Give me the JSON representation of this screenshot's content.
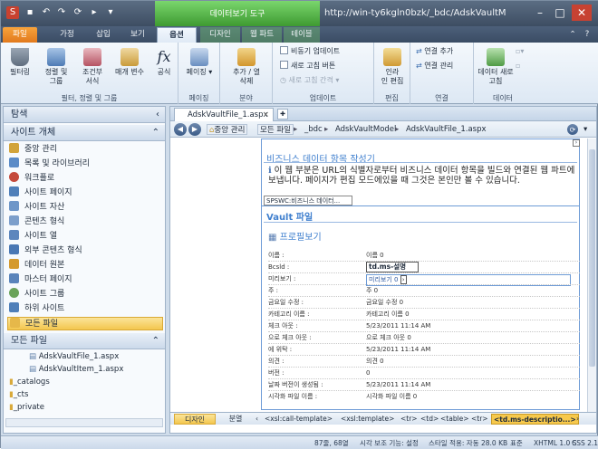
{
  "window": {
    "context_tool": "데이터보기 도구",
    "title": "http://win-ty6kgln0bzk/_bdc/AdskVaultModel..."
  },
  "tabs": [
    {
      "label": "파일"
    },
    {
      "label": "가정"
    },
    {
      "label": "삽입"
    },
    {
      "label": "보기"
    },
    {
      "label": "옵션"
    },
    {
      "label": "디자인"
    },
    {
      "label": "웹 파트"
    },
    {
      "label": "테이블"
    }
  ],
  "ribbon": {
    "g1": {
      "label": "필터, 정렬 및 그룹",
      "b1": "필터링",
      "b2a": "정렬 및",
      "b2b": "그룹",
      "b3a": "조건부",
      "b3b": "서식",
      "b4": "매개 변수",
      "b5": "공식"
    },
    "g2": {
      "label": "페이징",
      "b1": "페이징"
    },
    "g3": {
      "label": "분야",
      "b1a": "추가 / 열",
      "b1b": "삭제"
    },
    "g4": {
      "label": "업데이트",
      "s1": "비동기 업데이트",
      "s2": "새로 고침 버튼",
      "s3": "새로 고침 간격"
    },
    "g5": {
      "label": "편집",
      "b1a": "인라",
      "b1b": "인 편집"
    },
    "g6": {
      "label": "연결",
      "s1": "연결 추가",
      "s2": "연결 관리"
    },
    "g7": {
      "label": "데이터",
      "b1a": "데이터 새로",
      "b1b": "고침"
    }
  },
  "nav": {
    "header": "탐색",
    "section": "사이트 개체",
    "items": [
      {
        "label": "중앙 관리"
      },
      {
        "label": "목록 및 라이브러리"
      },
      {
        "label": "워크플로"
      },
      {
        "label": "사이트 페이지"
      },
      {
        "label": "사이트 자산"
      },
      {
        "label": "콘텐츠 형식"
      },
      {
        "label": "사이트 열"
      },
      {
        "label": "외부 콘텐츠 형식"
      },
      {
        "label": "데이터 원본"
      },
      {
        "label": "마스터 페이지"
      },
      {
        "label": "사이트 그룹"
      },
      {
        "label": "하위 사이트"
      },
      {
        "label": "모든 파일"
      }
    ],
    "section2": "모든 파일",
    "tree": [
      {
        "label": "AdskVaultFile_1.aspx"
      },
      {
        "label": "AdskVaultItem_1.aspx"
      },
      {
        "label": "_catalogs"
      },
      {
        "label": "_cts"
      },
      {
        "label": "_private"
      }
    ]
  },
  "doc": {
    "tab": "AdskVaultFile_1.aspx",
    "crumbs": [
      "중앙 관리",
      "모든 파일",
      "_bdc",
      "AdskVaultModel",
      "AdskVaultFile_1.aspx"
    ],
    "section1_title": "비즈니스 데이터 항목 작성기",
    "info_text": "이 웹 부분은 URL의 식별자로부터 비즈니스 데이터 항목을 빌드와 연결된 웹 파트에 보냅니다. 페이지가 편집 모드에있을 때 그것은 본인만 볼 수 있습니다.",
    "sps_label": "SPSWC:비즈니스 데이터...",
    "section2_title": "Vault 파일",
    "profile_title": "프로필보기",
    "tooltip": "td.ms-설명",
    "fields": [
      {
        "label": "이름 :",
        "value": "이름  0"
      },
      {
        "label": "Bcsld :",
        "value": ""
      },
      {
        "label": "미리보기 :",
        "value": "미리보기 0"
      },
      {
        "label": "주 :",
        "value": "주 0"
      },
      {
        "label": "금요일 수정 :",
        "value": "금요일 수정 0"
      },
      {
        "label": "카테고리 이름 :",
        "value": "카테고리 이름 0"
      },
      {
        "label": "체크 아웃 :",
        "value": "5/23/2011 11:14 AM"
      },
      {
        "label": "으로 체크 아웃 :",
        "value": "으로 체크 아웃 0"
      },
      {
        "label": "에 위탁 :",
        "value": "5/23/2011 11:14 AM"
      },
      {
        "label": "의견 :",
        "value": "의견 0"
      },
      {
        "label": "버전 :",
        "value": "0"
      },
      {
        "label": "날짜 버전이 생성됨 :",
        "value": "5/23/2011 11:14 AM"
      },
      {
        "label": "시각화 파일 이름 :",
        "value": "시각화 파일 이름 0"
      }
    ],
    "views": {
      "design": "디자인",
      "split": "분열"
    },
    "tags": [
      "<xsl:call-template>",
      "<xsl:template>",
      "<tr>",
      "<td>",
      "<table>",
      "<tr>",
      "<td.ms-descriptio...>"
    ]
  },
  "status": {
    "dims": "87줄, 68열",
    "visual": "시각 보조 기능: 설정",
    "style": "스타일 적용: 자동",
    "size": "28.0 KB",
    "mode": "표준",
    "xhtml": "XHTML 1.0 S",
    "css": "CSS 2.1"
  }
}
